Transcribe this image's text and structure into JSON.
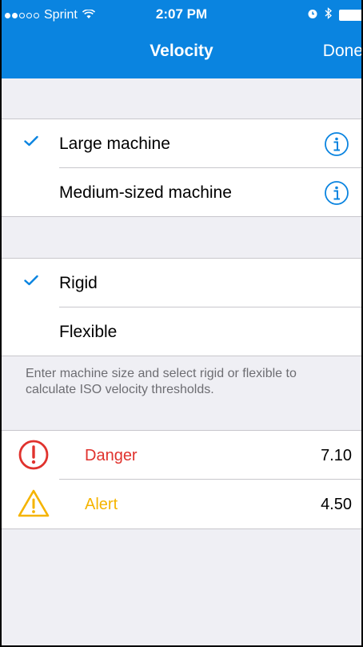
{
  "status_bar": {
    "carrier": "Sprint",
    "time": "2:07 PM",
    "signal_icon": "signal-dots-icon",
    "wifi_icon": "wifi-icon",
    "alarm_icon": "alarm-clock-icon",
    "bluetooth_icon": "bluetooth-icon",
    "battery_icon": "battery-icon"
  },
  "nav": {
    "title": "Velocity",
    "done_label": "Done",
    "background_color": "#0a84e0"
  },
  "machine_size": {
    "options": [
      {
        "label": "Large machine",
        "checked": true,
        "info_icon": "info-icon"
      },
      {
        "label": "Medium-sized machine",
        "checked": false,
        "info_icon": "info-icon"
      }
    ]
  },
  "mounting": {
    "options": [
      {
        "label": "Rigid",
        "checked": true
      },
      {
        "label": "Flexible",
        "checked": false
      }
    ]
  },
  "footer": {
    "text": "Enter machine size and select rigid or flexible to calculate ISO velocity thresholds."
  },
  "thresholds": [
    {
      "label": "Danger",
      "value": "7.10",
      "icon": "danger-exclamation-icon",
      "color": "#e0322d"
    },
    {
      "label": "Alert",
      "value": "4.50",
      "icon": "alert-warning-triangle-icon",
      "color": "#f5b400"
    }
  ],
  "colors": {
    "accent": "#0a84e0",
    "danger": "#e0322d",
    "alert": "#f5b400"
  }
}
